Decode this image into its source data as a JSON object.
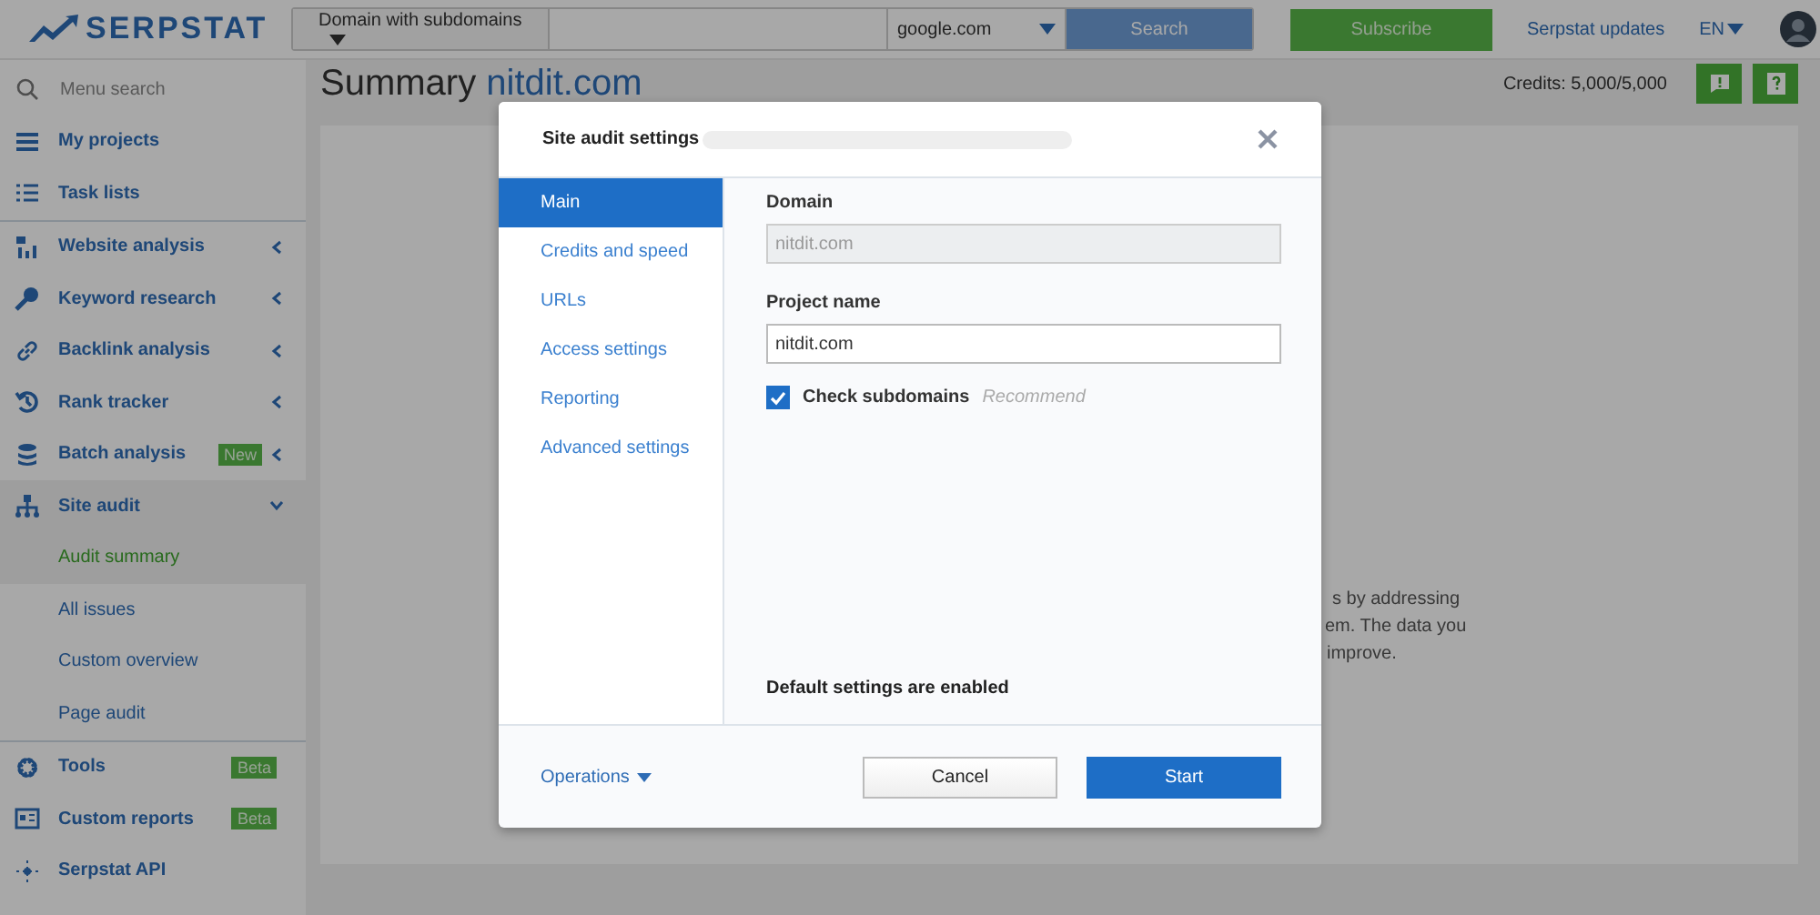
{
  "header": {
    "logo": "SERPSTAT",
    "search_type": "Domain with subdomains",
    "database": "google.com",
    "search_button": "Search",
    "subscribe_button": "Subscribe",
    "updates_link": "Serpstat updates",
    "language": "EN"
  },
  "sidebar": {
    "search_placeholder": "Menu search",
    "sections": [
      [
        {
          "label": "My projects"
        },
        {
          "label": "Task lists"
        }
      ],
      [
        {
          "label": "Website analysis",
          "expanded": false
        },
        {
          "label": "Keyword research",
          "expanded": false
        },
        {
          "label": "Backlink analysis",
          "expanded": false
        },
        {
          "label": "Rank tracker",
          "expanded": false
        },
        {
          "label": "Batch analysis",
          "badge": "New",
          "expanded": false
        },
        {
          "label": "Site audit",
          "expanded": true,
          "children": [
            {
              "label": "Audit summary",
              "selected": true
            },
            {
              "label": "All issues",
              "selected": false
            },
            {
              "label": "Custom overview",
              "selected": false
            },
            {
              "label": "Page audit",
              "selected": false
            }
          ]
        }
      ],
      [
        {
          "label": "Tools",
          "badge": "Beta"
        },
        {
          "label": "Custom reports",
          "badge": "Beta"
        },
        {
          "label": "Serpstat API"
        }
      ]
    ]
  },
  "page": {
    "title": "Summary",
    "domain": "nitdit.com",
    "credits": "Credits: 5,000/5,000",
    "background_text": [
      "s by addressing",
      "em. The data you",
      "improve."
    ]
  },
  "dialog": {
    "title": "Site audit settings",
    "nav": [
      {
        "label": "Main",
        "selected": true
      },
      {
        "label": "Credits and speed",
        "selected": false
      },
      {
        "label": "URLs",
        "selected": false
      },
      {
        "label": "Access settings",
        "selected": false
      },
      {
        "label": "Reporting",
        "selected": false
      },
      {
        "label": "Advanced settings",
        "selected": false
      }
    ],
    "domain": {
      "label": "Domain",
      "value": "nitdit.com",
      "disabled": true
    },
    "project_name": {
      "label": "Project name",
      "value": "nitdit.com",
      "disabled": false
    },
    "check_subdomains": {
      "label": "Check subdomains",
      "hint": "Recommend",
      "checked": true
    },
    "status": "Default settings are enabled",
    "operations": "Operations",
    "cancel": "Cancel",
    "start": "Start"
  }
}
